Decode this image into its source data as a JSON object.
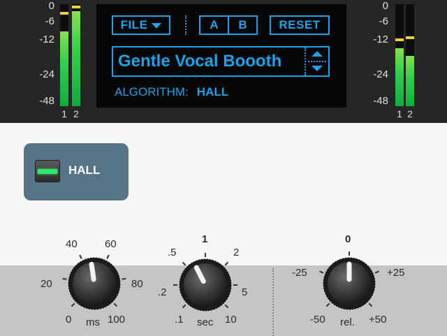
{
  "vu_left": {
    "scale": [
      "0",
      "-6",
      "-12",
      "-24",
      "-48"
    ],
    "channels": [
      {
        "label": "1",
        "level": 0.73,
        "peak": 0.9
      },
      {
        "label": "2",
        "level": 0.93,
        "peak": 0.96
      }
    ]
  },
  "vu_right": {
    "scale": [
      "0",
      "-6",
      "-12",
      "-24",
      "-48"
    ],
    "channels": [
      {
        "label": "1",
        "level": 0.57,
        "peak": 0.64
      },
      {
        "label": "2",
        "level": 0.49,
        "peak": 0.66
      }
    ]
  },
  "display": {
    "file_label": "FILE",
    "a_label": "A",
    "b_label": "B",
    "reset_label": "RESET",
    "preset_name": "Gentle Vocal Boooth",
    "algorithm_label": "ALGORITHM:",
    "algorithm_value": "HALL"
  },
  "mode_button": {
    "label": "HALL"
  },
  "knobs": {
    "predelay": {
      "ticks": [
        "0",
        "20",
        "40",
        "60",
        "80",
        "100"
      ],
      "unit": "ms",
      "position": 0.47
    },
    "decay": {
      "ticks": [
        ".1",
        ".2",
        ".5",
        "1",
        "2",
        "5",
        "10"
      ],
      "unit": "sec",
      "position": 0.4
    },
    "level": {
      "ticks": [
        "-50",
        "-25",
        "0",
        "+25",
        "+50"
      ],
      "unit": "rel.",
      "position": 0.5
    }
  },
  "colors": {
    "display_text": "#1aa3e8",
    "meter_green": "#34d04a",
    "meter_peak": "#e8d22c",
    "led_on": "#2fe870",
    "mode_button_bg": "#587487"
  }
}
